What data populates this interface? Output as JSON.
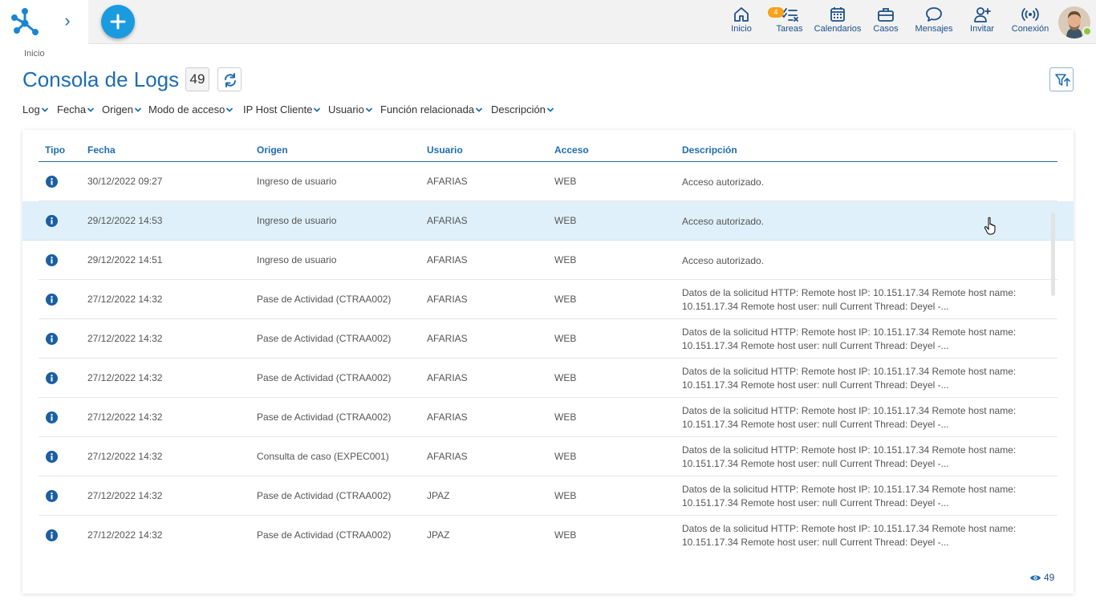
{
  "topbar": {
    "nav": [
      {
        "label": "Inicio",
        "icon": "home-icon"
      },
      {
        "label": "Tareas",
        "icon": "tasks-icon",
        "badge": "4"
      },
      {
        "label": "Calendarios",
        "icon": "calendar-icon"
      },
      {
        "label": "Casos",
        "icon": "briefcase-icon"
      },
      {
        "label": "Mensajes",
        "icon": "chat-icon"
      },
      {
        "label": "Invitar",
        "icon": "invite-user-icon"
      },
      {
        "label": "Conexión",
        "icon": "connection-icon"
      }
    ],
    "expand_glyph": "›"
  },
  "breadcrumb": "Inicio",
  "page": {
    "title": "Consola de Logs",
    "count": "49"
  },
  "filters": [
    "Log",
    "Fecha",
    "Origen",
    "Modo de acceso",
    "IP Host Cliente",
    "Usuario",
    "Función relacionada",
    "Descripción"
  ],
  "table": {
    "columns": [
      "Tipo",
      "Fecha",
      "Origen",
      "Usuario",
      "Acceso",
      "Descripción"
    ],
    "rows": [
      {
        "fecha": "30/12/2022 09:27",
        "origen": "Ingreso de usuario",
        "usuario": "AFARIAS",
        "acceso": "WEB",
        "descripcion": "Acceso autorizado."
      },
      {
        "fecha": "29/12/2022 14:53",
        "origen": "Ingreso de usuario",
        "usuario": "AFARIAS",
        "acceso": "WEB",
        "descripcion": "Acceso autorizado."
      },
      {
        "fecha": "29/12/2022 14:51",
        "origen": "Ingreso de usuario",
        "usuario": "AFARIAS",
        "acceso": "WEB",
        "descripcion": "Acceso autorizado."
      },
      {
        "fecha": "27/12/2022 14:32",
        "origen": "Pase de Actividad (CTRAA002)",
        "usuario": "AFARIAS",
        "acceso": "WEB",
        "descripcion": "Datos de la solicitud HTTP: Remote host IP: 10.151.17.34 Remote host name: 10.151.17.34 Remote host user: null Current Thread: Deyel -..."
      },
      {
        "fecha": "27/12/2022 14:32",
        "origen": "Pase de Actividad (CTRAA002)",
        "usuario": "AFARIAS",
        "acceso": "WEB",
        "descripcion": "Datos de la solicitud HTTP: Remote host IP: 10.151.17.34 Remote host name: 10.151.17.34 Remote host user: null Current Thread: Deyel -..."
      },
      {
        "fecha": "27/12/2022 14:32",
        "origen": "Pase de Actividad (CTRAA002)",
        "usuario": "AFARIAS",
        "acceso": "WEB",
        "descripcion": "Datos de la solicitud HTTP: Remote host IP: 10.151.17.34 Remote host name: 10.151.17.34 Remote host user: null Current Thread: Deyel -..."
      },
      {
        "fecha": "27/12/2022 14:32",
        "origen": "Pase de Actividad (CTRAA002)",
        "usuario": "AFARIAS",
        "acceso": "WEB",
        "descripcion": "Datos de la solicitud HTTP: Remote host IP: 10.151.17.34 Remote host name: 10.151.17.34 Remote host user: null Current Thread: Deyel -..."
      },
      {
        "fecha": "27/12/2022 14:32",
        "origen": "Consulta de caso (EXPEC001)",
        "usuario": "AFARIAS",
        "acceso": "WEB",
        "descripcion": "Datos de la solicitud HTTP: Remote host IP: 10.151.17.34 Remote host name: 10.151.17.34 Remote host user: null Current Thread: Deyel -..."
      },
      {
        "fecha": "27/12/2022 14:32",
        "origen": "Pase de Actividad (CTRAA002)",
        "usuario": "JPAZ",
        "acceso": "WEB",
        "descripcion": "Datos de la solicitud HTTP: Remote host IP: 10.151.17.34 Remote host name: 10.151.17.34 Remote host user: null Current Thread: Deyel -..."
      },
      {
        "fecha": "27/12/2022 14:32",
        "origen": "Pase de Actividad (CTRAA002)",
        "usuario": "JPAZ",
        "acceso": "WEB",
        "descripcion": "Datos de la solicitud HTTP: Remote host IP: 10.151.17.34 Remote host name: 10.151.17.34 Remote host user: null Current Thread: Deyel -..."
      }
    ],
    "selected_index": 1
  },
  "footer": {
    "visible_count": "49"
  },
  "colors": {
    "accent": "#1e6db2",
    "add_button": "#1a9be0",
    "badge": "#f7a21b",
    "selected_row": "#dff0fa",
    "online": "#8cc63f"
  }
}
